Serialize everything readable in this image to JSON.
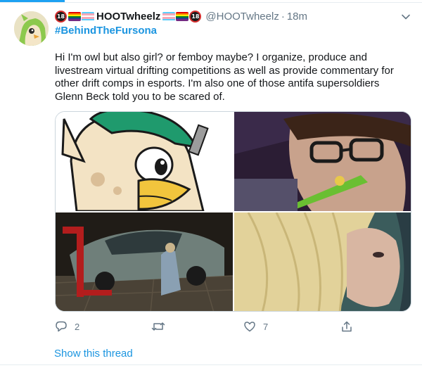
{
  "author": {
    "display_name": "HOOTwheelz",
    "handle": "@HOOTwheelz",
    "badge_text": "18",
    "time_separator": "·",
    "timestamp": "18m"
  },
  "tweet": {
    "hashtag": "#BehindTheFursona",
    "text": "Hi I'm owl but also girl? or femboy maybe? I organize, produce and livestream virtual drifting competitions as well as provide commentary for other drift comps in esports. I'm also one of those antifa supersoldiers Glenn Beck told you to be scared of."
  },
  "media": {
    "tiles": [
      {
        "name": "owl-cartoon-image"
      },
      {
        "name": "selfie-glasses-image"
      },
      {
        "name": "car-garage-image"
      },
      {
        "name": "blonde-hair-selfie-image"
      }
    ]
  },
  "actions": {
    "reply_count": "2",
    "retweet_count": "",
    "like_count": "7"
  },
  "show_thread_label": "Show this thread",
  "colors": {
    "link_blue": "#1b95e0",
    "accent": "#1da1f2",
    "text_primary": "#14171a",
    "text_secondary": "#657786",
    "border": "#e6ecf0"
  },
  "icons": [
    "reply-icon",
    "retweet-icon",
    "like-icon",
    "share-icon",
    "chevron-down-icon",
    "trans-flag-icon",
    "rainbow-flag-icon",
    "age-18-badge-icon"
  ]
}
